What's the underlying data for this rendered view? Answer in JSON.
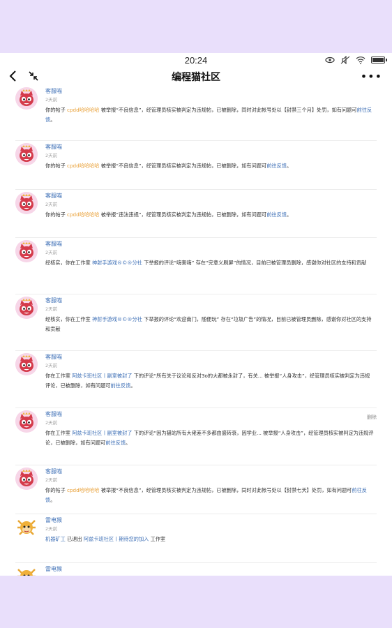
{
  "status": {
    "time": "20:24"
  },
  "nav": {
    "title": "编程猫社区"
  },
  "items": [
    {
      "name": "客服喵",
      "time": "2天前",
      "p1": "你的帖子 ",
      "link1": "cpdd哈哈哈哈",
      "p2": " 被举报“不良信息”，经管理员核实被判定为违规帖，已被删除，同时对此帐号处以【封禁三个月】处罚，如有问题可",
      "link2": "前往反馈",
      "p3": "。",
      "delete": ""
    },
    {
      "name": "客服喵",
      "time": "2天前",
      "p1": "你的帖子 ",
      "link1": "cpdd哈哈哈哈",
      "p2": " 被举报“不良信息”，经管理员核实被判定为违规帖，已被删除，如有问题可",
      "link2": "前往反馈",
      "p3": "。",
      "delete": ""
    },
    {
      "name": "客服喵",
      "time": "2天前",
      "p1": "你的帖子 ",
      "link1": "cpdd哈哈哈哈",
      "p2": " 被举报“违法违规”，经管理员核实被判定为违规帖，已被删除，如有问题可",
      "link2": "前往反馈",
      "p3": "。",
      "delete": ""
    },
    {
      "name": "客服喵",
      "time": "2天前",
      "p1": "经核实，你在工作室 ",
      "link1": "神射手游戏®©®分社",
      "p2": " 下举报的评论“嗨害嗨” 存在“完意义刷屏”的情况，目前已被管理员删除，感谢你对社区的支持和贡献",
      "link2": "",
      "p3": "",
      "delete": ""
    },
    {
      "name": "客服喵",
      "time": "2天前",
      "p1": "经核实，你在工作室 ",
      "link1": "神射手游戏®©®分社",
      "p2": " 下举报的评论“欢迎南门，随便玩” 存在“垃圾广告”的情况，目前已被管理员删除，感谢你对社区的支持和贡献",
      "link2": "",
      "p3": "",
      "delete": ""
    },
    {
      "name": "客服喵",
      "time": "2天前",
      "p1": "你在工作室 ",
      "link1": "阿兹卡班社区丨副室被封了",
      "p2": " 下的评论“所有关于议论和反对3o的大都被永封了，有关... 被举报“人身攻击”，经管理员核实被判定为违规评论，已被删除，如有问题可",
      "link2": "前往反馈",
      "p3": "。",
      "delete": ""
    },
    {
      "name": "客服喵",
      "time": "2天前",
      "p1": "你在工作室 ",
      "link1": "阿兹卡班社区丨副室被封了",
      "p2": " 下的评论“因为猫站所有大佬差不多都由盛转衰，因学业... 被举报“人身攻击”，经管理员核实被判定为违规评论，已被删除，如有问题可",
      "link2": "前往反馈",
      "p3": "。",
      "delete": "删除"
    },
    {
      "name": "客服喵",
      "time": "2天前",
      "p1": "你的帖子 ",
      "link1": "cpdd哈哈哈哈",
      "p2": " 被举报“不良信息”，经管理员核实被判定为违规帖，已被删除，同时对此帐号处以【封禁七天】处罚，如有问题可",
      "link2": "前往反馈",
      "p3": "。",
      "delete": ""
    },
    {
      "name": "雷电猴",
      "time": "2天前",
      "p1": "",
      "link1": "机器矿工",
      "p2": " 已退出 ",
      "link2": "阿兹卡班社区丨期待您的加入",
      "p3": " 工作室",
      "delete": ""
    },
    {
      "name": "雷电猴",
      "time": "",
      "p1": "",
      "link1": "",
      "p2": "",
      "link2": "",
      "p3": "",
      "delete": ""
    }
  ]
}
